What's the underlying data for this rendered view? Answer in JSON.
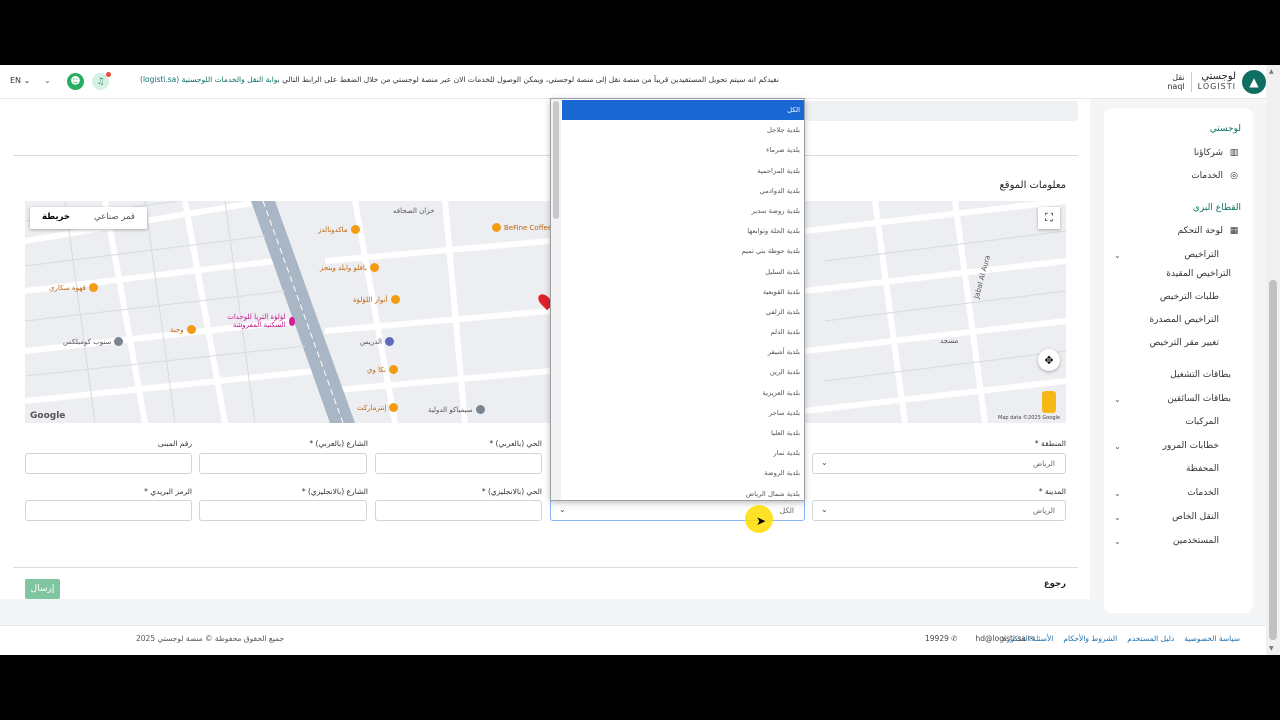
{
  "header": {
    "logo_name": "لوجستي",
    "logo_latin": "LOGISTI",
    "naql_ar": "نقل",
    "naql_en": "naql",
    "notice": "نفيدكم انه سيتم تحويل المستفيدين قريباً من منصة نقل إلى منصة لوجستي، ويمكن الوصول للخدمات الان عبر منصة لوجستي من خلال الضغط على الرابط التالي",
    "notice_link": "بوابة النقل والخدمات اللوجستية (logisti.sa)",
    "lang": "EN"
  },
  "sidebar": {
    "section1": "لوجستي",
    "partners": "شركاؤنا",
    "services_top": "الخدمات",
    "section2": "القطاع البري",
    "dashboard": "لوحة التحكم",
    "licenses": "التراخيص",
    "restricted": "التراخيص المقيدة",
    "license_requests": "طلبات الترخيص",
    "issued": "التراخيص المصدرة",
    "change_hq": "تغيير مقر الترخيص",
    "operation_cards": "بطاقات التشغيل",
    "driver_cards": "بطاقات السائقين",
    "vehicles": "المركبات",
    "traffic_letters": "خطابات المرور",
    "wallet": "المحفظة",
    "services": "الخدمات",
    "private_transport": "النقل الخاص",
    "users": "المستخدمين"
  },
  "form": {
    "section_title": "معلومات الموقع",
    "map_tab_map": "خريطة",
    "map_tab_satellite": "قمر صناعي",
    "map_attribution": "Map data ©2025 Google",
    "labels": {
      "region": "المنطقة *",
      "district_ar": "الحي (بالعربي) *",
      "street_ar": "الشارع (بالعربي) *",
      "building_no": "رقم المبنى",
      "city": "المدينة *",
      "district_en": "الحي (بالانجليزي) *",
      "street_en": "الشارع (بالانجليزي) *",
      "postal_code": "الرمز البريدي *"
    },
    "region_value": "الرياض",
    "city_value": "الرياض",
    "municipality_value": "الكل",
    "back": "رجوع",
    "submit": "إرسال"
  },
  "map": {
    "labels": [
      "خزان الصحافه",
      "ماكدونالدز",
      "بافلو وايلد وينجز",
      "أنوار اللؤلؤة",
      "قهوة سكاري",
      "لؤلؤة الثريا للوحدات السكنية المفروشة",
      "سنوب كومبلكس",
      "وجبة",
      "الدريس",
      "نكا وي",
      "إنترماركت",
      "سيمباكو الدولية",
      "BeFine Coffee",
      "مسجد",
      "Jabal Al Aura"
    ]
  },
  "dropdown": {
    "options": [
      "الكل",
      "بلدية جلاجل",
      "بلدية ضرماء",
      "بلدية المزاحمية",
      "بلدية الدوادمي",
      "بلدية روضة سدير",
      "بلدية الحلة وتوابعها",
      "بلدية حوطة بني تميم",
      "بلدية السليل",
      "بلدية القويعية",
      "بلدية الزلفي",
      "بلدية الدلم",
      "بلدية أشيقر",
      "بلدية الرين",
      "بلدية العزيزية",
      "بلدية ساجر",
      "بلدية العليا",
      "بلدية نمار",
      "بلدية الروضة",
      "بلدية شمال الرياض"
    ]
  },
  "footer": {
    "links": [
      "سياسة الخصوصية",
      "دليل المستخدم",
      "الشروط والأحكام",
      "الأسئلة المتكررة"
    ],
    "email": "hd@logisti.sa",
    "phone": "19929",
    "copyright": "جميع الحقوق محفوظة © منصة لوجستي 2025"
  },
  "colors": {
    "brand": "#0f6e62",
    "selected_option": "#1967d2",
    "submit": "#7fc5a0"
  }
}
